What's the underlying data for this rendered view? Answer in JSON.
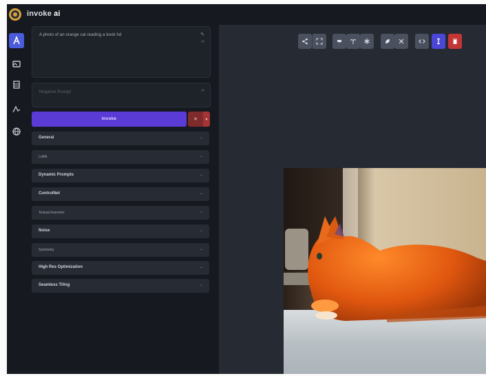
{
  "app": {
    "name": "invoke",
    "name_suffix": "ai",
    "logo_icon": "invoke-logo-icon"
  },
  "nav": [
    {
      "id": "text-to-image",
      "icon": "text-to-image-icon",
      "active": true
    },
    {
      "id": "image-to-image",
      "icon": "image-icon",
      "active": false
    },
    {
      "id": "unified-canvas",
      "icon": "canvas-icon",
      "active": false
    },
    {
      "id": "node-editor",
      "icon": "nodes-icon",
      "active": false
    },
    {
      "id": "model-manager",
      "icon": "globe-icon",
      "active": false
    }
  ],
  "prompt": {
    "value": "A photo of an orange cat reading a book hd",
    "negative_placeholder": "Negative Prompt"
  },
  "invoke_button": {
    "label": "Invoke"
  },
  "cancel_button": {
    "label": "✕",
    "caret": "▾"
  },
  "sections": [
    {
      "label": "General",
      "dim": false
    },
    {
      "label": "LoRA",
      "dim": true
    },
    {
      "label": "Dynamic Prompts",
      "dim": false
    },
    {
      "label": "ControlNet",
      "dim": false
    },
    {
      "label": "Textual Inversion",
      "dim": true
    },
    {
      "label": "Noise",
      "dim": false
    },
    {
      "label": "Symmetry",
      "dim": true
    },
    {
      "label": "High Res Optimization",
      "dim": false
    },
    {
      "label": "Seamless Tiling",
      "dim": false
    }
  ],
  "toolbar": [
    {
      "name": "share-button",
      "icon": "share-icon",
      "group": 0
    },
    {
      "name": "expand-button",
      "icon": "expand-icon",
      "group": 0
    },
    {
      "name": "use-prompt-button",
      "icon": "quote-icon",
      "group": 1
    },
    {
      "name": "use-seed-button",
      "icon": "seed-icon",
      "group": 1
    },
    {
      "name": "use-all-button",
      "icon": "asterisk-icon",
      "group": 1
    },
    {
      "name": "upscale-button",
      "icon": "upscale-icon",
      "group": 2
    },
    {
      "name": "face-restore-button",
      "icon": "face-icon",
      "group": 2
    },
    {
      "name": "show-metadata-button",
      "icon": "code-icon",
      "group": 3
    },
    {
      "name": "toggle-viewer-button",
      "icon": "info-icon",
      "group": 4,
      "color": "#4a47d6"
    },
    {
      "name": "delete-button",
      "icon": "trash-icon",
      "group": 5,
      "color": "#c43636"
    }
  ]
}
